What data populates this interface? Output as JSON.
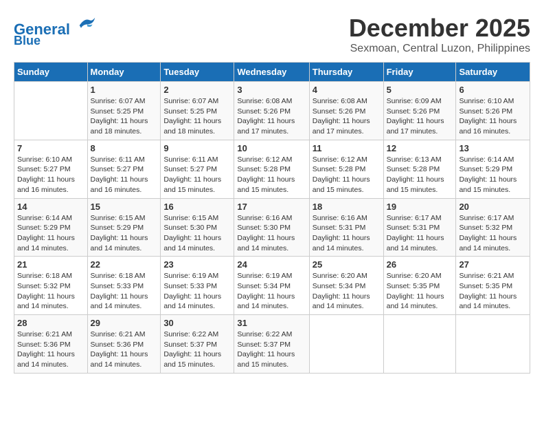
{
  "header": {
    "logo_line1": "General",
    "logo_line2": "Blue",
    "month": "December 2025",
    "location": "Sexmoan, Central Luzon, Philippines"
  },
  "weekdays": [
    "Sunday",
    "Monday",
    "Tuesday",
    "Wednesday",
    "Thursday",
    "Friday",
    "Saturday"
  ],
  "weeks": [
    [
      {
        "day": "",
        "info": ""
      },
      {
        "day": "1",
        "info": "Sunrise: 6:07 AM\nSunset: 5:25 PM\nDaylight: 11 hours\nand 18 minutes."
      },
      {
        "day": "2",
        "info": "Sunrise: 6:07 AM\nSunset: 5:25 PM\nDaylight: 11 hours\nand 18 minutes."
      },
      {
        "day": "3",
        "info": "Sunrise: 6:08 AM\nSunset: 5:26 PM\nDaylight: 11 hours\nand 17 minutes."
      },
      {
        "day": "4",
        "info": "Sunrise: 6:08 AM\nSunset: 5:26 PM\nDaylight: 11 hours\nand 17 minutes."
      },
      {
        "day": "5",
        "info": "Sunrise: 6:09 AM\nSunset: 5:26 PM\nDaylight: 11 hours\nand 17 minutes."
      },
      {
        "day": "6",
        "info": "Sunrise: 6:10 AM\nSunset: 5:26 PM\nDaylight: 11 hours\nand 16 minutes."
      }
    ],
    [
      {
        "day": "7",
        "info": "Sunrise: 6:10 AM\nSunset: 5:27 PM\nDaylight: 11 hours\nand 16 minutes."
      },
      {
        "day": "8",
        "info": "Sunrise: 6:11 AM\nSunset: 5:27 PM\nDaylight: 11 hours\nand 16 minutes."
      },
      {
        "day": "9",
        "info": "Sunrise: 6:11 AM\nSunset: 5:27 PM\nDaylight: 11 hours\nand 15 minutes."
      },
      {
        "day": "10",
        "info": "Sunrise: 6:12 AM\nSunset: 5:28 PM\nDaylight: 11 hours\nand 15 minutes."
      },
      {
        "day": "11",
        "info": "Sunrise: 6:12 AM\nSunset: 5:28 PM\nDaylight: 11 hours\nand 15 minutes."
      },
      {
        "day": "12",
        "info": "Sunrise: 6:13 AM\nSunset: 5:28 PM\nDaylight: 11 hours\nand 15 minutes."
      },
      {
        "day": "13",
        "info": "Sunrise: 6:14 AM\nSunset: 5:29 PM\nDaylight: 11 hours\nand 15 minutes."
      }
    ],
    [
      {
        "day": "14",
        "info": "Sunrise: 6:14 AM\nSunset: 5:29 PM\nDaylight: 11 hours\nand 14 minutes."
      },
      {
        "day": "15",
        "info": "Sunrise: 6:15 AM\nSunset: 5:29 PM\nDaylight: 11 hours\nand 14 minutes."
      },
      {
        "day": "16",
        "info": "Sunrise: 6:15 AM\nSunset: 5:30 PM\nDaylight: 11 hours\nand 14 minutes."
      },
      {
        "day": "17",
        "info": "Sunrise: 6:16 AM\nSunset: 5:30 PM\nDaylight: 11 hours\nand 14 minutes."
      },
      {
        "day": "18",
        "info": "Sunrise: 6:16 AM\nSunset: 5:31 PM\nDaylight: 11 hours\nand 14 minutes."
      },
      {
        "day": "19",
        "info": "Sunrise: 6:17 AM\nSunset: 5:31 PM\nDaylight: 11 hours\nand 14 minutes."
      },
      {
        "day": "20",
        "info": "Sunrise: 6:17 AM\nSunset: 5:32 PM\nDaylight: 11 hours\nand 14 minutes."
      }
    ],
    [
      {
        "day": "21",
        "info": "Sunrise: 6:18 AM\nSunset: 5:32 PM\nDaylight: 11 hours\nand 14 minutes."
      },
      {
        "day": "22",
        "info": "Sunrise: 6:18 AM\nSunset: 5:33 PM\nDaylight: 11 hours\nand 14 minutes."
      },
      {
        "day": "23",
        "info": "Sunrise: 6:19 AM\nSunset: 5:33 PM\nDaylight: 11 hours\nand 14 minutes."
      },
      {
        "day": "24",
        "info": "Sunrise: 6:19 AM\nSunset: 5:34 PM\nDaylight: 11 hours\nand 14 minutes."
      },
      {
        "day": "25",
        "info": "Sunrise: 6:20 AM\nSunset: 5:34 PM\nDaylight: 11 hours\nand 14 minutes."
      },
      {
        "day": "26",
        "info": "Sunrise: 6:20 AM\nSunset: 5:35 PM\nDaylight: 11 hours\nand 14 minutes."
      },
      {
        "day": "27",
        "info": "Sunrise: 6:21 AM\nSunset: 5:35 PM\nDaylight: 11 hours\nand 14 minutes."
      }
    ],
    [
      {
        "day": "28",
        "info": "Sunrise: 6:21 AM\nSunset: 5:36 PM\nDaylight: 11 hours\nand 14 minutes."
      },
      {
        "day": "29",
        "info": "Sunrise: 6:21 AM\nSunset: 5:36 PM\nDaylight: 11 hours\nand 14 minutes."
      },
      {
        "day": "30",
        "info": "Sunrise: 6:22 AM\nSunset: 5:37 PM\nDaylight: 11 hours\nand 15 minutes."
      },
      {
        "day": "31",
        "info": "Sunrise: 6:22 AM\nSunset: 5:37 PM\nDaylight: 11 hours\nand 15 minutes."
      },
      {
        "day": "",
        "info": ""
      },
      {
        "day": "",
        "info": ""
      },
      {
        "day": "",
        "info": ""
      }
    ]
  ]
}
